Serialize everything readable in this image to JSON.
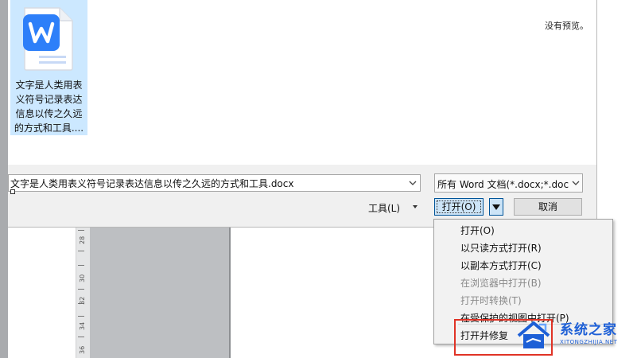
{
  "file_pane": {
    "file_name": "文字是人类用表义符号记录表达信息以传之久远的方式和工具....",
    "icon": "wps-word-document-icon"
  },
  "preview": {
    "empty_text": "没有预览。"
  },
  "filename_field": {
    "value": "文字是人类用表义符号记录表达信息以传之久远的方式和工具.docx"
  },
  "filetype_select": {
    "selected": "所有 Word 文档(*.docx;*.doc"
  },
  "buttons": {
    "tools": "工具(L)",
    "open": "打开(O)",
    "cancel": "取消"
  },
  "open_menu": {
    "items": [
      {
        "label": "打开(O)",
        "enabled": true
      },
      {
        "label": "以只读方式打开(R)",
        "enabled": true
      },
      {
        "label": "以副本方式打开(C)",
        "enabled": true
      },
      {
        "label": "在浏览器中打开(B)",
        "enabled": false
      },
      {
        "label": "打开时转换(T)",
        "enabled": false
      },
      {
        "label": "在受保护的视图中打开(P)",
        "enabled": true
      },
      {
        "label": "打开并修复",
        "enabled": true
      }
    ]
  },
  "ruler": {
    "ticks": [
      "28",
      "30",
      "32",
      "34",
      "36"
    ]
  },
  "watermark": {
    "title": "系统之家",
    "subtitle": "XITONGZHIJIA.NET"
  },
  "colors": {
    "selection": "#cce8ff",
    "button_focus": "#cce4f7",
    "highlight_box": "#e03326",
    "word_blue": "#2d7ff9",
    "watermark_blue": "#1d5fd6"
  }
}
